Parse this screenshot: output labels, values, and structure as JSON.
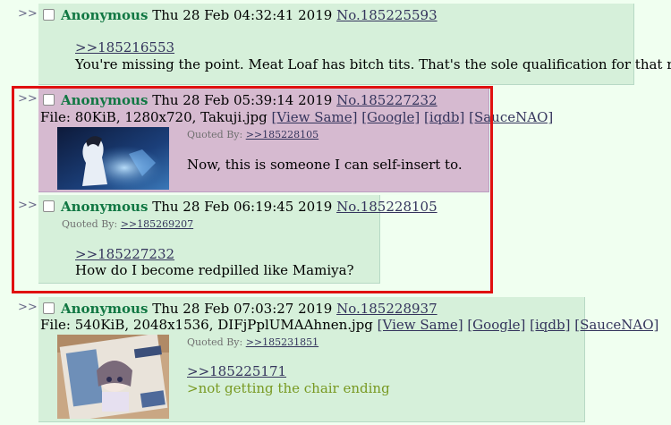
{
  "arrow": ">>",
  "posts": [
    {
      "name": "Anonymous",
      "date": "Thu 28 Feb 04:32:41 2019",
      "number": "No.185225593",
      "reply_link": ">>185216553",
      "message": "You're missing the point. Meat Loaf has bitch tits. That's the sole qualification for that role."
    },
    {
      "name": "Anonymous",
      "date": "Thu 28 Feb 05:39:14 2019",
      "number": "No.185227232",
      "file_prefix": "File: 80KiB, 1280x720, Takuji.jpg",
      "file_links": [
        "[View Same]",
        "[Google]",
        "[iqdb]",
        "[SauceNAO]"
      ],
      "quoted_by_label": "Quoted By:",
      "quoted_by_link": ">>185228105",
      "message": "Now, this is someone I can self-insert to."
    },
    {
      "name": "Anonymous",
      "date": "Thu 28 Feb 06:19:45 2019",
      "number": "No.185228105",
      "quoted_by_label": "Quoted By:",
      "quoted_by_link": ">>185269207",
      "reply_link": ">>185227232",
      "message": "How do I become redpilled like Mamiya?"
    },
    {
      "name": "Anonymous",
      "date": "Thu 28 Feb 07:03:27 2019",
      "number": "No.185228937",
      "file_prefix": "File: 540KiB, 2048x1536, DIFjPplUMAAhnen.jpg",
      "file_links": [
        "[View Same]",
        "[Google]",
        "[iqdb]",
        "[SauceNAO]"
      ],
      "quoted_by_label": "Quoted By:",
      "quoted_by_link": ">>185231851",
      "reply_link": ">>185225171",
      "message": ">not getting the chair ending"
    }
  ],
  "colors": {
    "highlight_box": "#e01010",
    "name_green": "#117743",
    "greentext": "#789922",
    "link": "#34345c"
  }
}
